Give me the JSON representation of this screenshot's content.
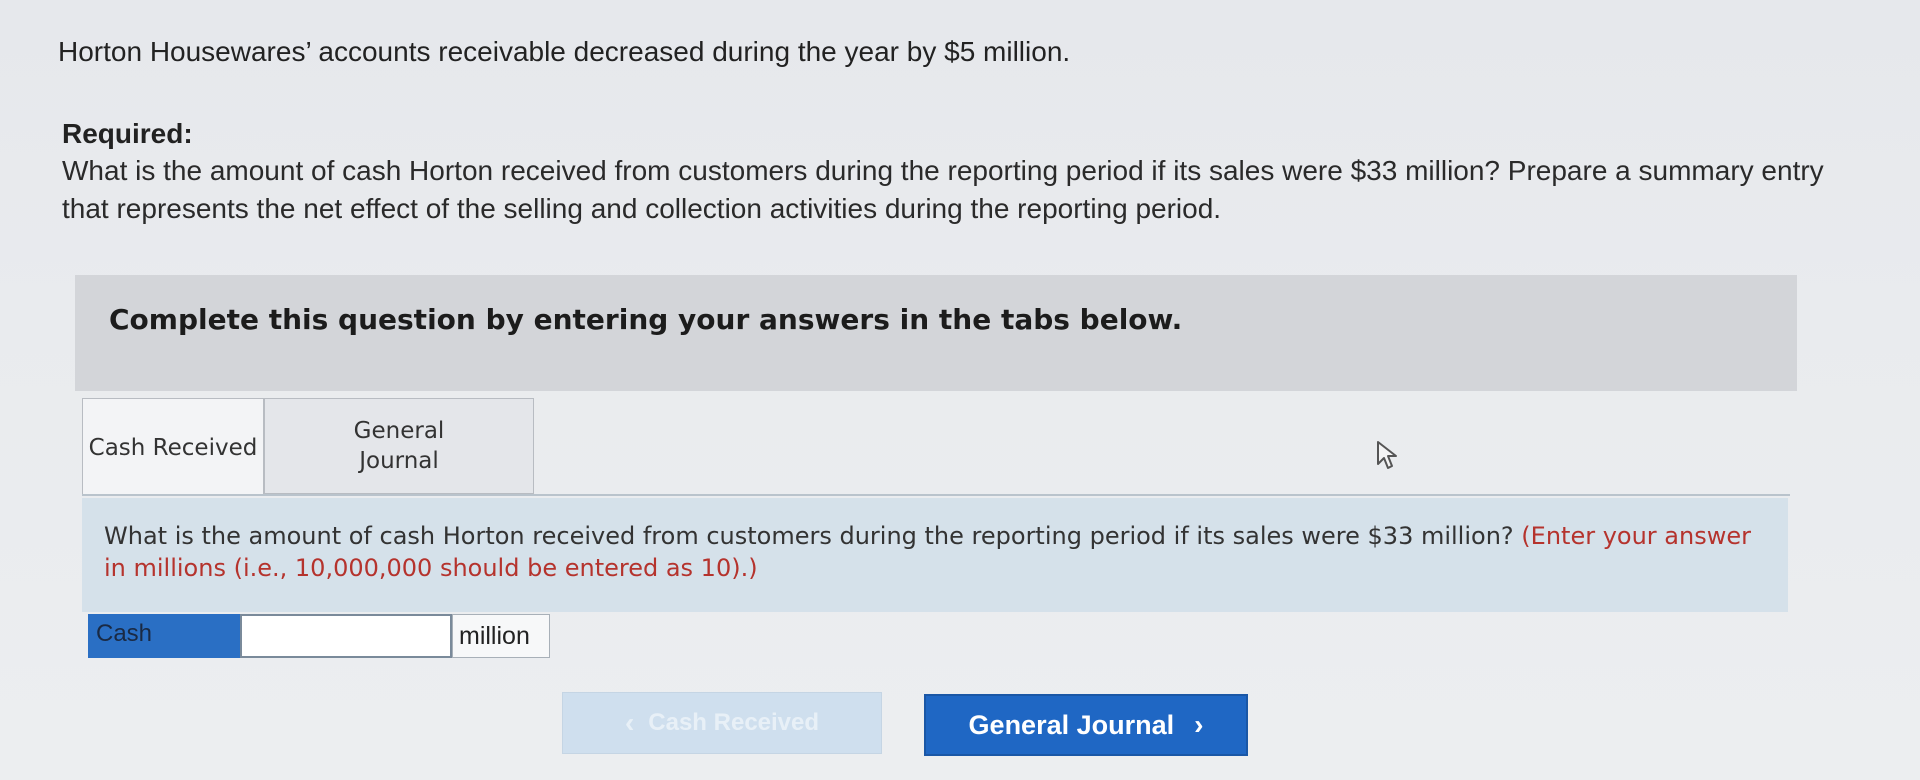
{
  "problem": {
    "intro": "Horton Housewares’ accounts receivable decreased during the year by $5 million.",
    "required_label": "Required:",
    "required_text": "What is the amount of cash Horton received from customers during the reporting period if its sales were $33 million? Prepare a summary entry that represents the net effect of the selling and collection activities during the reporting period."
  },
  "banner": {
    "text": "Complete this question by entering your answers in the tabs below."
  },
  "tabs": [
    {
      "label": "Cash Received",
      "active": true
    },
    {
      "label": "General\nJournal",
      "active": false
    }
  ],
  "question": {
    "text": "What is the amount of cash Horton received from customers during the reporting period if its sales were $33 million?",
    "note": "(Enter your answer in millions (i.e., 10,000,000 should be entered as 10).)"
  },
  "answer": {
    "label": "Cash",
    "value": "",
    "unit": "million"
  },
  "nav": {
    "prev_label": "Cash Received",
    "next_label": "General Journal",
    "prev_icon": "chevron-left-icon",
    "next_icon": "chevron-right-icon"
  },
  "colors": {
    "accent": "#1f67c4",
    "note": "#b5332d",
    "question_bg": "#d5e1ea"
  }
}
